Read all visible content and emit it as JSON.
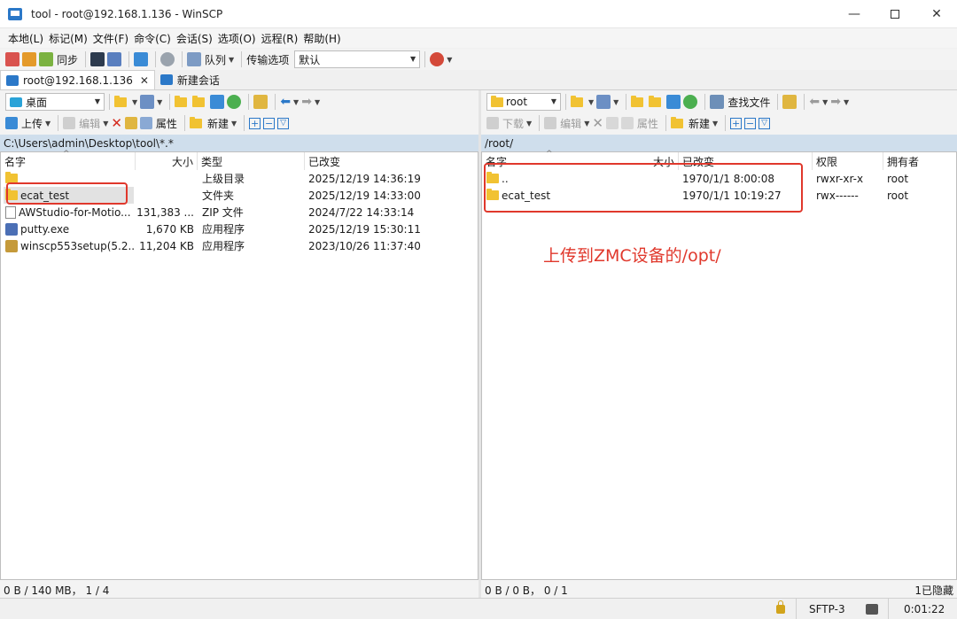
{
  "window": {
    "title": "tool - root@192.168.1.136 - WinSCP",
    "minimize": "—",
    "close": "✕"
  },
  "menu": [
    "本地(L)",
    "标记(M)",
    "文件(F)",
    "命令(C)",
    "会话(S)",
    "选项(O)",
    "远程(R)",
    "帮助(H)"
  ],
  "toolbar": {
    "sync_label": "同步",
    "queue_label": "队列",
    "transfer_label": "传输选项",
    "transfer_value": "默认"
  },
  "tabs": {
    "session": "root@192.168.1.136",
    "close_glyph": "✕",
    "new_session": "新建会话"
  },
  "colors": {
    "annotation_red": "#e0382c",
    "path_bar": "#cfdeec",
    "folder": "#f1c232"
  },
  "left_panel": {
    "location": "桌面",
    "upload": "上传",
    "edit": "编辑",
    "properties": "属性",
    "new": "新建",
    "path": "C:\\Users\\admin\\Desktop\\tool\\*.*",
    "columns": {
      "name": "名字",
      "size": "大小",
      "type": "类型",
      "modified": "已改变"
    },
    "rows": [
      {
        "name": "",
        "size": "",
        "type": "上级目录",
        "modified": "2025/12/19  14:36:19",
        "icon": "folder-up"
      },
      {
        "name": "ecat_test",
        "size": "",
        "type": "文件夹",
        "modified": "2025/12/19  14:33:00",
        "icon": "folder"
      },
      {
        "name": "AWStudio-for-Motio...",
        "size": "131,383 ...",
        "type": "ZIP 文件",
        "modified": "2024/7/22  14:33:14",
        "icon": "file"
      },
      {
        "name": "putty.exe",
        "size": "1,670 KB",
        "type": "应用程序",
        "modified": "2025/12/19  15:30:11",
        "icon": "exe"
      },
      {
        "name": "winscp553setup(5.2...",
        "size": "11,204 KB",
        "type": "应用程序",
        "modified": "2023/10/26  11:37:40",
        "icon": "package"
      }
    ],
    "status": "0 B / 140 MB，  1 / 4"
  },
  "right_panel": {
    "location": "root",
    "find_files": "查找文件",
    "download": "下载",
    "edit": "编辑",
    "properties": "属性",
    "new": "新建",
    "path": "/root/",
    "columns": {
      "name": "名字",
      "size": "大小",
      "modified": "已改变",
      "permissions": "权限",
      "owner": "拥有者"
    },
    "rows": [
      {
        "name": "..",
        "modified": "1970/1/1 8:00:08",
        "permissions": "rwxr-xr-x",
        "owner": "root"
      },
      {
        "name": "ecat_test",
        "modified": "1970/1/1 10:19:27",
        "permissions": "rwx------",
        "owner": "root"
      }
    ],
    "status": "0 B / 0 B，  0 / 1",
    "hidden": "1已隐藏"
  },
  "annotation": "上传到ZMC设备的/opt/",
  "statusbar": {
    "protocol": "SFTP-3",
    "timer": "0:01:22"
  }
}
